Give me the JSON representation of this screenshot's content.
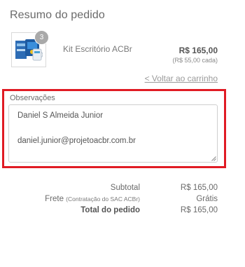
{
  "summary": {
    "title": "Resumo do pedido",
    "back_link": "< Voltar ao carrinho"
  },
  "product": {
    "quantity": "3",
    "name": "Kit Escritório ACBr",
    "price": "R$ 165,00",
    "unit_price": "(R$ 55,00 cada)"
  },
  "observations": {
    "label": "Observações",
    "line_1": "Daniel S Almeida Junior",
    "line_2": "daniel.junior@projetoacbr.com.br"
  },
  "totals": {
    "subtotal_label": "Subtotal",
    "subtotal_value": "R$ 165,00",
    "shipping_label": "Frete",
    "shipping_note": "(Contratação do SAC ACBr)",
    "shipping_value": "Grátis",
    "total_label": "Total do pedido",
    "total_value": "R$ 165,00"
  },
  "colors": {
    "highlight": "#e01b24",
    "text": "#666666"
  }
}
